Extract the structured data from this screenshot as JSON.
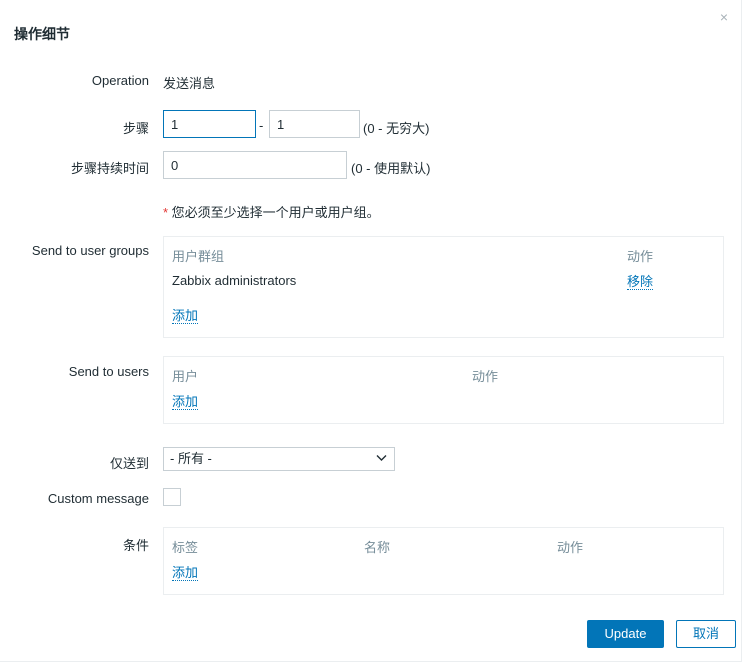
{
  "dialog": {
    "title": "操作细节",
    "close_symbol": "×"
  },
  "operation": {
    "label": "Operation",
    "value": "发送消息"
  },
  "steps": {
    "label": "步骤",
    "from": "1",
    "separator": "-",
    "to": "1",
    "hint": "(0 - 无穷大)"
  },
  "step_duration": {
    "label": "步骤持续时间",
    "value": "0",
    "hint": "(0 - 使用默认)"
  },
  "requirement": {
    "asterisk": "*",
    "text": " 您必须至少选择一个用户或用户组。"
  },
  "user_groups": {
    "label": "Send to user groups",
    "col_group": "用户群组",
    "col_action": "动作",
    "rows": [
      {
        "name": "Zabbix administrators",
        "action": "移除"
      }
    ],
    "add": "添加"
  },
  "users": {
    "label": "Send to users",
    "col_user": "用户",
    "col_action": "动作",
    "add": "添加"
  },
  "send_only_to": {
    "label": "仅送到",
    "selected": "- 所有 -"
  },
  "custom_message": {
    "label": "Custom message",
    "checked": false
  },
  "conditions": {
    "label": "条件",
    "col_label": "标签",
    "col_name": "名称",
    "col_action": "动作",
    "add": "添加"
  },
  "buttons": {
    "update": "Update",
    "cancel": "取消"
  },
  "colors": {
    "primary": "#0275b8",
    "required": "#e33734",
    "muted": "#768d99"
  }
}
